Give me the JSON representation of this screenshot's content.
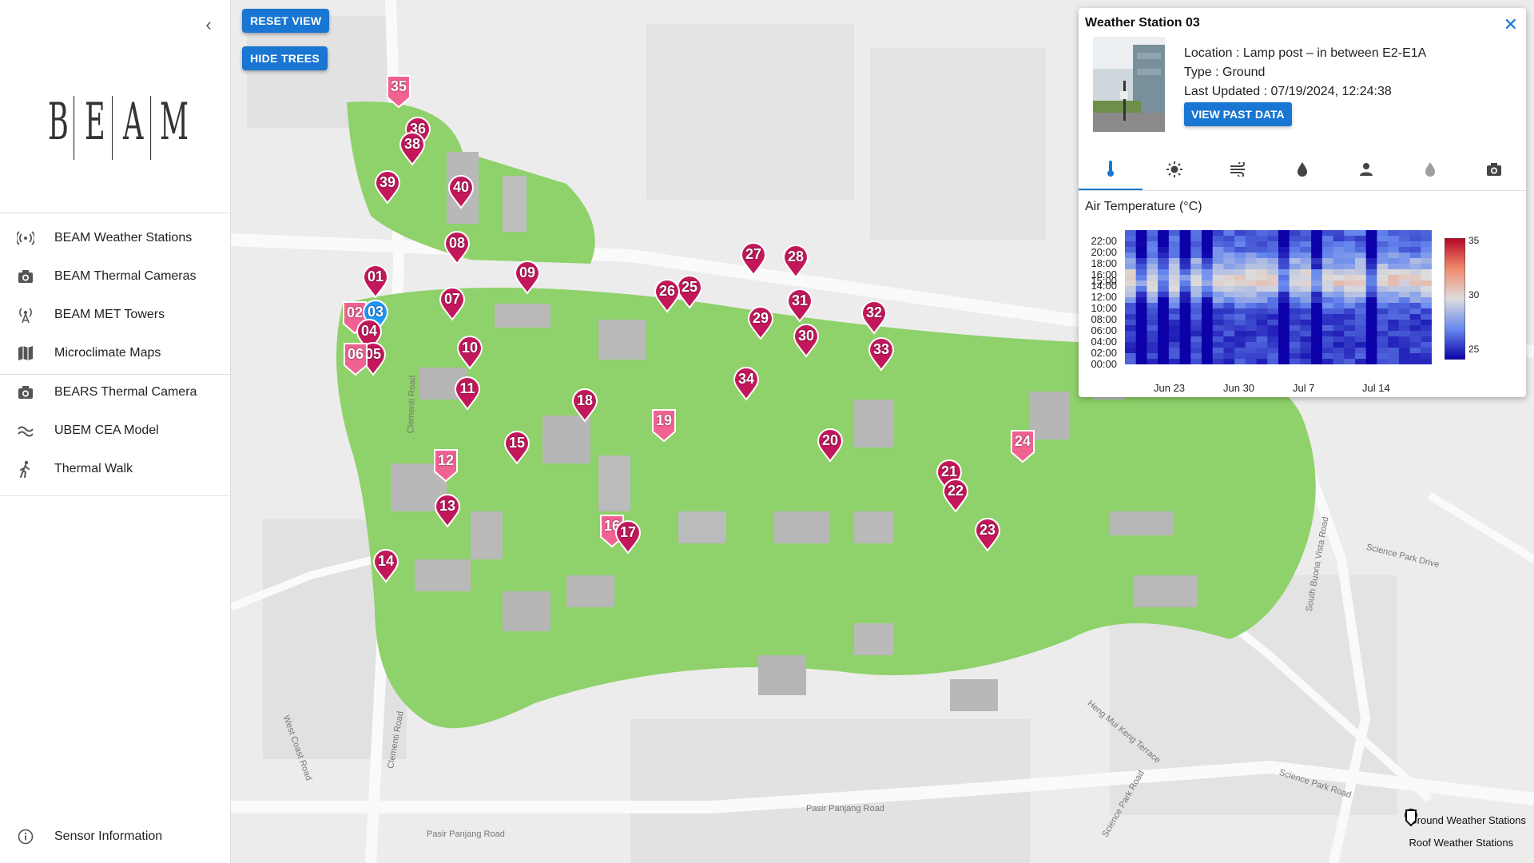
{
  "sidebar": {
    "logo_text": "BEAM",
    "items": [
      {
        "label": "BEAM Weather Stations",
        "icon": "broadcast-icon"
      },
      {
        "label": "BEAM Thermal Cameras",
        "icon": "camera-icon"
      },
      {
        "label": "BEAM MET Towers",
        "icon": "antenna-icon"
      },
      {
        "label": "Microclimate Maps",
        "icon": "map-icon"
      },
      {
        "label": "BEARS Thermal Camera",
        "icon": "camera-icon"
      },
      {
        "label": "UBEM CEA Model",
        "icon": "waves-icon"
      },
      {
        "label": "Thermal Walk",
        "icon": "walk-icon"
      }
    ],
    "footer_label": "Sensor Information"
  },
  "map": {
    "reset_label": "RESET VIEW",
    "hide_trees_label": "HIDE TREES",
    "road_labels": [
      "Pasir Panjang Road",
      "Pasir Panjang Road",
      "West Coast Road",
      "Clementi Road",
      "Clementi Road",
      "South Buona Vista Road",
      "Science Park Road",
      "Science Park Road",
      "Heng Mui Keng Terrace",
      "Science Park Drive"
    ],
    "stations": [
      "35",
      "36",
      "38",
      "39",
      "40",
      "08",
      "09",
      "01",
      "07",
      "02",
      "03",
      "04",
      "05",
      "06",
      "10",
      "11",
      "12",
      "13",
      "14",
      "15",
      "16",
      "17",
      "18",
      "19",
      "20",
      "21",
      "22",
      "23",
      "24",
      "25",
      "26",
      "27",
      "28",
      "29",
      "30",
      "31",
      "32",
      "33",
      "34"
    ]
  },
  "popup": {
    "title": "Weather Station 03",
    "location": "Location : Lamp post – in between E2-E1A",
    "type": "Type : Ground",
    "last_updated": "Last Updated : 07/19/2024, 12:24:38",
    "view_past_label": "VIEW PAST DATA",
    "tabs": [
      "thermometer-icon",
      "sun-icon",
      "wind-icon",
      "droplet-icon",
      "person-icon",
      "rain-icon",
      "camera-icon"
    ],
    "active_tab": 0
  },
  "chart_data": {
    "type": "heatmap",
    "title": "Air Temperature (°C)",
    "y_ticks": [
      "22:00",
      "20:00",
      "18:00",
      "16:00",
      "15:00",
      "14:00",
      "12:00",
      "10:00",
      "08:00",
      "06:00",
      "04:00",
      "02:00",
      "00:00"
    ],
    "x_ticks": [
      "Jun 23",
      "Jun 30",
      "Jul 7",
      "Jul 14"
    ],
    "colorbar": {
      "min": 25,
      "max": 35,
      "ticks": [
        35,
        30,
        25
      ],
      "colormap": "coolwarm"
    },
    "rows": 24,
    "days": 28
  },
  "legend": {
    "ground_label": "Ground Weather Stations",
    "roof_label": "Roof Weather Stations"
  },
  "colors": {
    "accent": "#1976d2",
    "pin_dark": "#c2185b",
    "pin_light": "#f06292",
    "pin_selected": "#2196f3",
    "trees": "#8fd16a"
  }
}
